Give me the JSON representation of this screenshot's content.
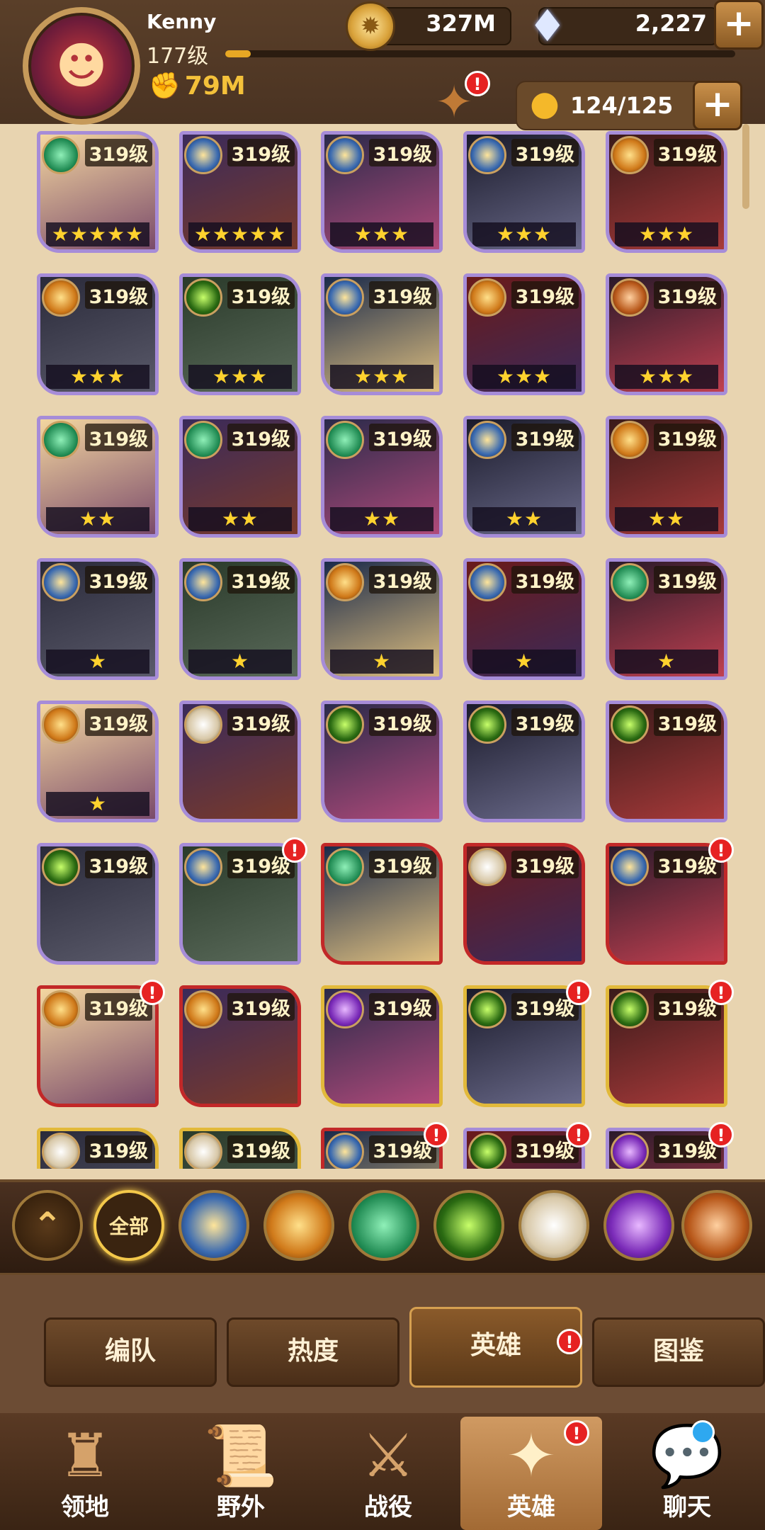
{
  "header": {
    "player_name": "Kenny",
    "player_level": "177级",
    "xp_progress": 0.05,
    "power": "79M",
    "gold": "327M",
    "gems": "2,227",
    "team_count": "124/125"
  },
  "heroes": {
    "level_label": "319级",
    "cards": [
      {
        "stars": "★★★★★",
        "frame": "purple",
        "faction": "lifeguard",
        "alert": false
      },
      {
        "stars": "★★★★★",
        "frame": "purple",
        "faction": "celestial",
        "alert": false
      },
      {
        "stars": "★★★",
        "frame": "purple",
        "faction": "celestial",
        "alert": false
      },
      {
        "stars": "★★★",
        "frame": "purple",
        "faction": "celestial",
        "alert": false
      },
      {
        "stars": "★★★",
        "frame": "purple",
        "faction": "lightbearer",
        "alert": false
      },
      {
        "stars": "★★★",
        "frame": "purple",
        "faction": "lightbearer",
        "alert": false
      },
      {
        "stars": "★★★",
        "frame": "purple",
        "faction": "graveborn",
        "alert": false
      },
      {
        "stars": "★★★",
        "frame": "purple",
        "faction": "celestial",
        "alert": false
      },
      {
        "stars": "★★★",
        "frame": "purple",
        "faction": "lightbearer",
        "alert": false
      },
      {
        "stars": "★★★",
        "frame": "purple",
        "faction": "mauler",
        "alert": false
      },
      {
        "stars": "★★",
        "frame": "purple",
        "faction": "lifeguard",
        "alert": false
      },
      {
        "stars": "★★",
        "frame": "purple",
        "faction": "lifeguard",
        "alert": false
      },
      {
        "stars": "★★",
        "frame": "purple",
        "faction": "lifeguard",
        "alert": false
      },
      {
        "stars": "★★",
        "frame": "purple",
        "faction": "celestial",
        "alert": false
      },
      {
        "stars": "★★",
        "frame": "purple",
        "faction": "lightbearer",
        "alert": false
      },
      {
        "stars": "★",
        "frame": "purple",
        "faction": "celestial",
        "alert": false
      },
      {
        "stars": "★",
        "frame": "purple",
        "faction": "celestial",
        "alert": false
      },
      {
        "stars": "★",
        "frame": "purple",
        "faction": "lightbearer",
        "alert": false
      },
      {
        "stars": "★",
        "frame": "purple",
        "faction": "celestial",
        "alert": false
      },
      {
        "stars": "★",
        "frame": "purple",
        "faction": "lifeguard",
        "alert": false
      },
      {
        "stars": "★",
        "frame": "purple",
        "faction": "lightbearer",
        "alert": false
      },
      {
        "stars": "",
        "frame": "purple",
        "faction": "hypogean",
        "alert": false
      },
      {
        "stars": "",
        "frame": "purple",
        "faction": "graveborn",
        "alert": false
      },
      {
        "stars": "",
        "frame": "purple",
        "faction": "graveborn",
        "alert": false
      },
      {
        "stars": "",
        "frame": "purple",
        "faction": "graveborn",
        "alert": false
      },
      {
        "stars": "",
        "frame": "purple",
        "faction": "graveborn",
        "alert": false
      },
      {
        "stars": "",
        "frame": "purple",
        "faction": "celestial",
        "alert": true
      },
      {
        "stars": "",
        "frame": "red",
        "faction": "lifeguard",
        "alert": false
      },
      {
        "stars": "",
        "frame": "red",
        "faction": "hypogean",
        "alert": false
      },
      {
        "stars": "",
        "frame": "red",
        "faction": "celestial",
        "alert": true
      },
      {
        "stars": "",
        "frame": "red",
        "faction": "lightbearer",
        "alert": true
      },
      {
        "stars": "",
        "frame": "red",
        "faction": "lightbearer",
        "alert": false
      },
      {
        "stars": "",
        "frame": "gold",
        "faction": "dimensional",
        "alert": false
      },
      {
        "stars": "",
        "frame": "gold",
        "faction": "graveborn",
        "alert": true
      },
      {
        "stars": "",
        "frame": "gold",
        "faction": "graveborn",
        "alert": true
      },
      {
        "stars": "",
        "frame": "gold",
        "faction": "hypogean",
        "alert": false
      },
      {
        "stars": "",
        "frame": "gold",
        "faction": "hypogean",
        "alert": false
      },
      {
        "stars": "",
        "frame": "red",
        "faction": "celestial",
        "alert": true
      },
      {
        "stars": "",
        "frame": "purple",
        "faction": "graveborn",
        "alert": true
      },
      {
        "stars": "",
        "frame": "purple",
        "faction": "dimensional",
        "alert": true
      }
    ]
  },
  "filters": {
    "all_label": "全部",
    "items": [
      "collapse",
      "all",
      "celestial",
      "lightbearer",
      "lifeguard",
      "graveborn",
      "hypogean",
      "dimensional",
      "mauler"
    ]
  },
  "sub_tabs": [
    "编队",
    "热度",
    "英雄",
    "图鉴"
  ],
  "bottom_nav": [
    "领地",
    "野外",
    "战役",
    "英雄",
    "聊天"
  ],
  "colors": {
    "frame_purple": "#a68cd8",
    "frame_red": "#c22828",
    "frame_gold": "#e2b93a",
    "star": "#ffd22e",
    "alert": "#e62222"
  }
}
